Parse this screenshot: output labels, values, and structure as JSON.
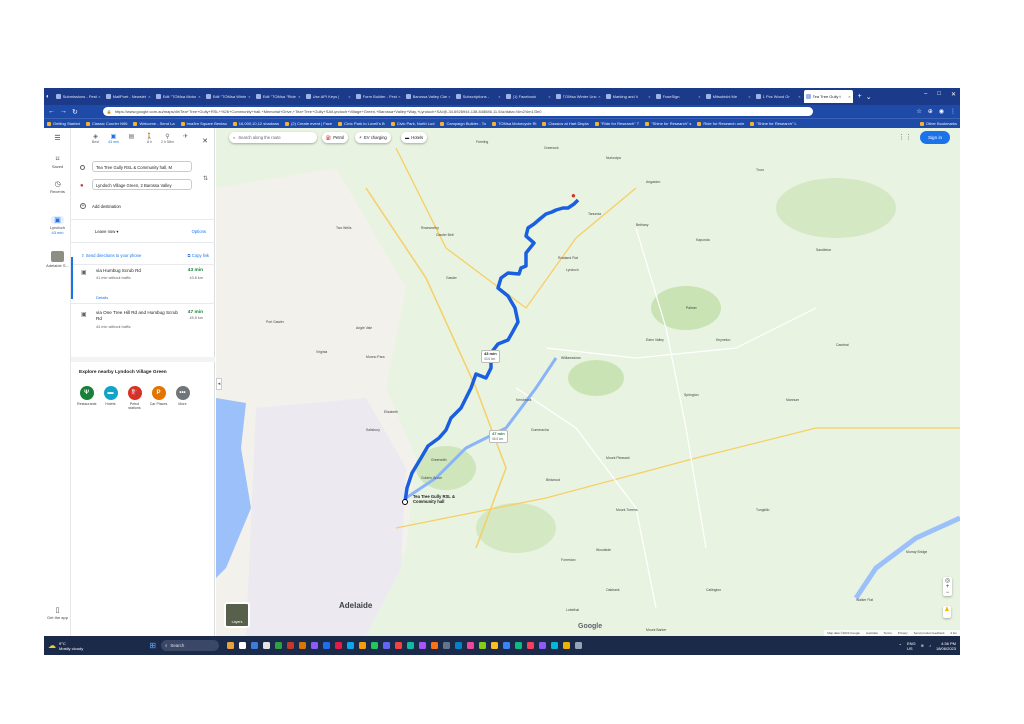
{
  "browser": {
    "tabs": [
      {
        "label": "Submissions - Festi"
      },
      {
        "label": "MailPoet - Newslet"
      },
      {
        "label": "Edit \"TOMsa Motor"
      },
      {
        "label": "Edit \"TOMsa Winte"
      },
      {
        "label": "Edit \"TOMsa \"Ride"
      },
      {
        "label": "Use API Keys |"
      },
      {
        "label": "Form Builder - Festi"
      },
      {
        "label": "Barossa Valley Clas"
      },
      {
        "label": "Subscriptions -"
      },
      {
        "label": "(1) Facebook"
      },
      {
        "label": "TOMsa Winter Unc"
      },
      {
        "label": "Marking and V"
      },
      {
        "label": "FuseSign"
      },
      {
        "label": "Mitsubishi Me"
      },
      {
        "label": "1 Pcs Wood Gr"
      },
      {
        "label": "Tea Tree Gully t"
      }
    ],
    "active_tab_index": 15,
    "url": "https://www.google.com.au/maps/dir/Tea+Tree+Gully+RSL+%26+Community+hall,+Memorial+Drive,+Tea+Tree+Gully+SA/Lyndoch+Village+Green,+Barossa+Valley+Way,+Lyndoch+SA/@-34.6926944,138.848586,11.54z/data=!4m2!4m1!3e0",
    "bookmarks": [
      {
        "label": "Getting Started"
      },
      {
        "label": "Classic Courier N96"
      },
      {
        "label": "Welcome - Send La"
      },
      {
        "label": "Ima3rn Square Bentao"
      },
      {
        "label": "16,000,10,12 shadows"
      },
      {
        "label": "(2) Create event | Face"
      },
      {
        "label": "Civic Park to Lovell's B"
      },
      {
        "label": "Civic Park, North Lud"
      },
      {
        "label": "Campaign Builder - To"
      },
      {
        "label": "TOMsa Motorcycle Ri"
      },
      {
        "label": "Classics at Hart Displa"
      },
      {
        "label": "\"Ride for Research\" T"
      },
      {
        "label": "\"Shine for Research\" s"
      },
      {
        "label": "Ride for Research onle"
      },
      {
        "label": "\"Shine for Research\" L"
      }
    ],
    "other_bookmarks": "Other Bookmarks"
  },
  "rail": {
    "saved": "Saved",
    "recents": "Recents",
    "recent_trip_label": "Lyndoch",
    "recent_trip_time": "43 min",
    "recent_place_label": "Adelaide S...",
    "get_app": "Get the app"
  },
  "travel_modes": [
    {
      "name": "Best",
      "icon": "diamond-icon"
    },
    {
      "name": "43 min",
      "icon": "car-icon"
    },
    {
      "name": "",
      "icon": "bus-icon"
    },
    {
      "name": "8 h",
      "icon": "walk-icon"
    },
    {
      "name": "2 h 58m",
      "icon": "bike-icon"
    },
    {
      "name": "",
      "icon": "plane-icon"
    }
  ],
  "origin": "Tea Tree Gully RSL & Community hall, M",
  "destination": "Lyndoch Village Green, 2 Barossa Valley",
  "add_destination": "Add destination",
  "leave_now": "Leave now",
  "options": "Options",
  "send_directions": "Send directions to your phone",
  "copy_link": "Copy link",
  "routes": [
    {
      "name": "via Humbug Scrub Rd",
      "time": "43 min",
      "traffic": "41 min without traffic",
      "distance": "43.6 km",
      "details": "Details"
    },
    {
      "name": "via One Tree Hill Rd and Humbug Scrub Rd",
      "time": "47 min",
      "traffic": "44 min without traffic",
      "distance": "45.5 km"
    }
  ],
  "explore": {
    "title": "Explore nearby Lyndoch Village Green",
    "categories": [
      {
        "label": "Restaurants",
        "color": "#188038",
        "glyph": "Ψ"
      },
      {
        "label": "Hotels",
        "color": "#12a4c8",
        "glyph": "▬"
      },
      {
        "label": "Petrol stations",
        "color": "#d93025",
        "glyph": "⛽"
      },
      {
        "label": "Car Places",
        "color": "#e37400",
        "glyph": "P"
      },
      {
        "label": "More",
        "color": "#70757a",
        "glyph": "•••"
      }
    ]
  },
  "map": {
    "search_placeholder": "Search along the route",
    "chips": [
      {
        "label": "Petrol"
      },
      {
        "label": "EV charging"
      },
      {
        "label": "Hotels"
      }
    ],
    "sign_in": "Sign in",
    "route_bubble_primary": {
      "time": "43 min",
      "distance": "43.6 km"
    },
    "route_bubble_alt": {
      "time": "47 min",
      "distance": "45.5 km"
    },
    "start_label": "Tea Tree Gully RSL & Community hall",
    "city_label": "Adelaide",
    "layers_label": "Layers",
    "google": "Google",
    "attribution": [
      "Map data ©2023 Google",
      "Australia",
      "Terms",
      "Privacy",
      "Send product feedback",
      "2 km"
    ],
    "places": [
      "Freeling",
      "Greenock",
      "Nuriootpa",
      "Angaston",
      "Tanunda",
      "Rowland Flat",
      "Lyndoch",
      "Williamstown",
      "Gawler",
      "Roseworthy",
      "Two Wells",
      "Port Gawler",
      "Angle Vale",
      "Virginia",
      "Munno Para",
      "Elizabeth",
      "Salisbury",
      "Golden Grove",
      "Greenwith",
      "Mount Pleasant",
      "Birdwood",
      "Gumeracha",
      "Springton",
      "Eden Valley",
      "Keyneton",
      "Palmer",
      "Mannum",
      "Cambrai",
      "Forreston",
      "Lobethal",
      "Woodside",
      "Oakbank",
      "Mount Barker",
      "Callington",
      "Murray Bridge",
      "Tungkillo",
      "Kersbrook",
      "Mount Torrens",
      "Gawler Belt",
      "Bethany",
      "Kapunda",
      "Truro",
      "Sandleton",
      "Walker Flat"
    ]
  },
  "taskbar": {
    "temperature": "9°C",
    "weather": "Mostly cloudy",
    "search": "Search",
    "language": "ENG",
    "region": "US",
    "time": "4:36 PM",
    "date": "18/06/2023"
  },
  "colors": {
    "route_primary": "#1a5fe0",
    "route_alt": "#8ab4f8",
    "accent": "#1a73e8",
    "time_green": "#188038"
  }
}
